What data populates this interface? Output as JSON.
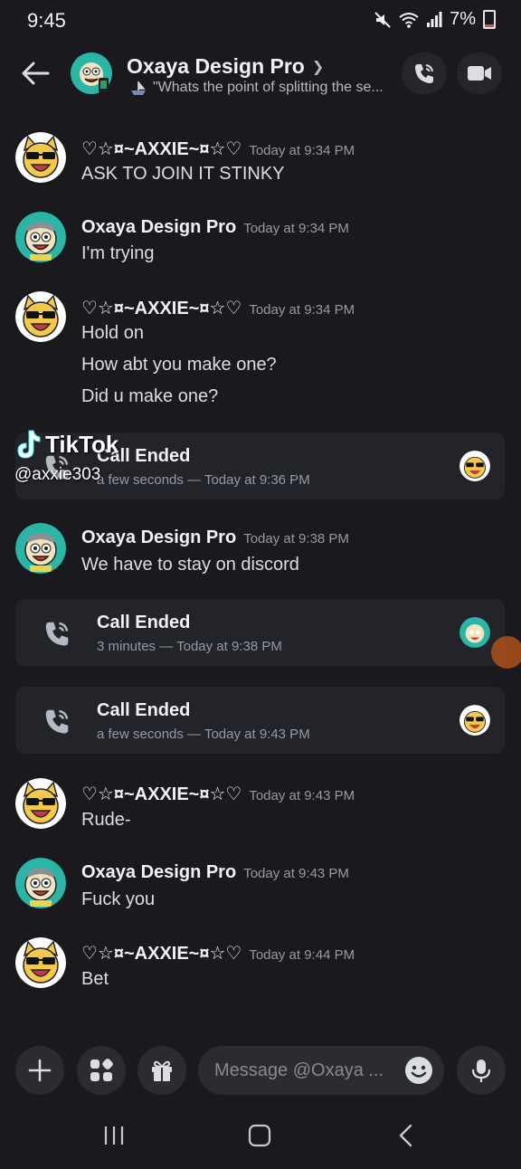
{
  "status_bar": {
    "time": "9:45",
    "battery": "7%"
  },
  "header": {
    "title": "Oxaya Design Pro",
    "status_text": "\"Whats the point of splitting the se..."
  },
  "messages": [
    {
      "author": "♡☆¤~AXXIE~¤☆♡",
      "timestamp": "Today at 9:34 PM",
      "lines": [
        "ASK TO JOIN IT STINKY"
      ]
    },
    {
      "author": "Oxaya Design Pro",
      "timestamp": "Today at 9:34 PM",
      "lines": [
        "I'm trying"
      ]
    },
    {
      "author": "♡☆¤~AXXIE~¤☆♡",
      "timestamp": "Today at 9:34 PM",
      "lines": [
        "Hold on",
        "How abt you make one?",
        "Did u make one?"
      ]
    },
    {
      "author": "Oxaya Design Pro",
      "timestamp": "Today at 9:38 PM",
      "lines": [
        "We have to stay on discord"
      ]
    },
    {
      "author": "♡☆¤~AXXIE~¤☆♡",
      "timestamp": "Today at 9:43 PM",
      "lines": [
        "Rude-"
      ]
    },
    {
      "author": "Oxaya Design Pro",
      "timestamp": "Today at 9:43 PM",
      "lines": [
        "Fuck you"
      ]
    },
    {
      "author": "♡☆¤~AXXIE~¤☆♡",
      "timestamp": "Today at 9:44 PM",
      "lines": [
        "Bet"
      ]
    }
  ],
  "calls": [
    {
      "title": "Call Ended",
      "subtitle": "a few seconds — Today at 9:36 PM"
    },
    {
      "title": "Call Ended",
      "subtitle": "3 minutes — Today at 9:38 PM"
    },
    {
      "title": "Call Ended",
      "subtitle": "a few seconds — Today at 9:43 PM"
    }
  ],
  "watermark": {
    "brand": "TikTok",
    "handle": "@axxie303"
  },
  "composer": {
    "placeholder": "Message @Oxaya ..."
  },
  "colors": {
    "background": "#1a1a1e",
    "card": "#23232a",
    "avatar_oxaya": "#2bb5a6",
    "avatar_axxie": "#ffffff",
    "muted": "#949ba4"
  }
}
